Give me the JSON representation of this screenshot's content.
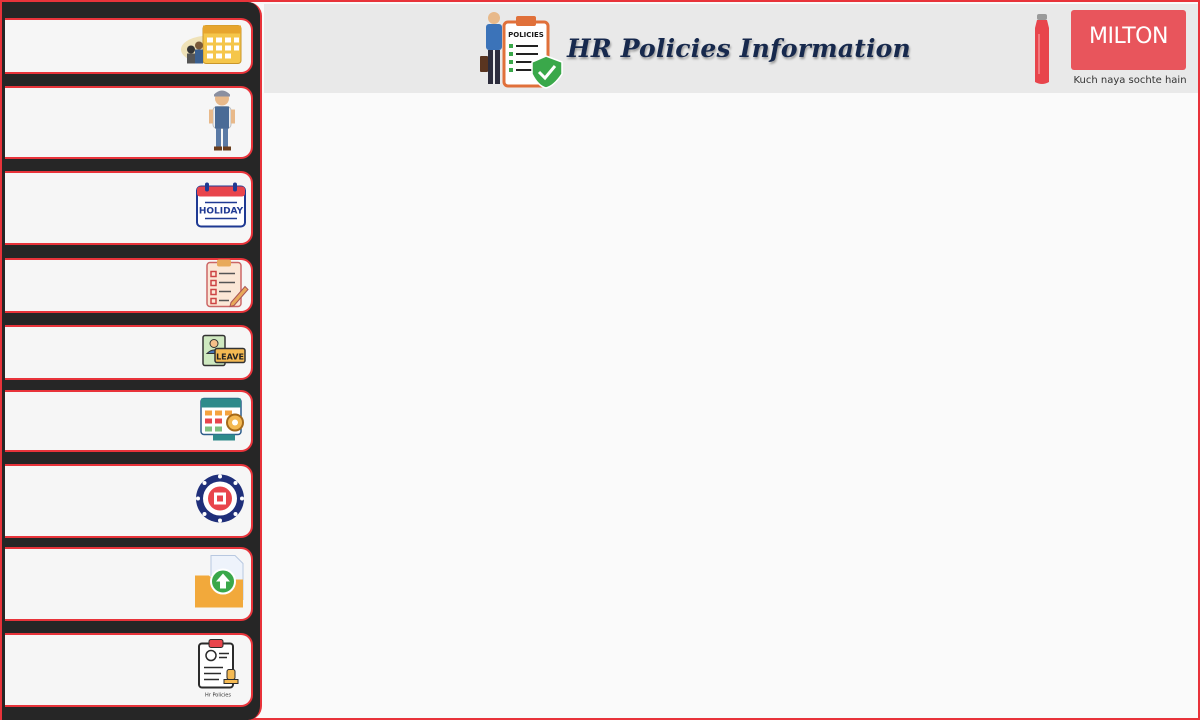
{
  "header": {
    "title": "HR Policies Information",
    "policy_badge_text": "POLICIES",
    "brand": {
      "name": "MILTON",
      "tagline": "Kuch naya sochte hain",
      "color": "#e8555c"
    }
  },
  "sidebar": {
    "items": [
      {
        "icon": "calendar-people-icon"
      },
      {
        "icon": "employee-figure-icon"
      },
      {
        "icon": "holiday-calendar-icon",
        "icon_text": "HOLIDAY"
      },
      {
        "icon": "checklist-clipboard-icon"
      },
      {
        "icon": "leave-form-icon",
        "icon_text": "LEAVE"
      },
      {
        "icon": "schedule-settings-icon"
      },
      {
        "icon": "epfo-emblem-icon"
      },
      {
        "icon": "upload-folder-icon"
      },
      {
        "icon": "hr-policies-clipboard-icon",
        "icon_text": "Hr Policies"
      }
    ]
  },
  "colors": {
    "accent": "#e8333a",
    "sidebar_bg": "#262626",
    "title": "#17294d"
  }
}
